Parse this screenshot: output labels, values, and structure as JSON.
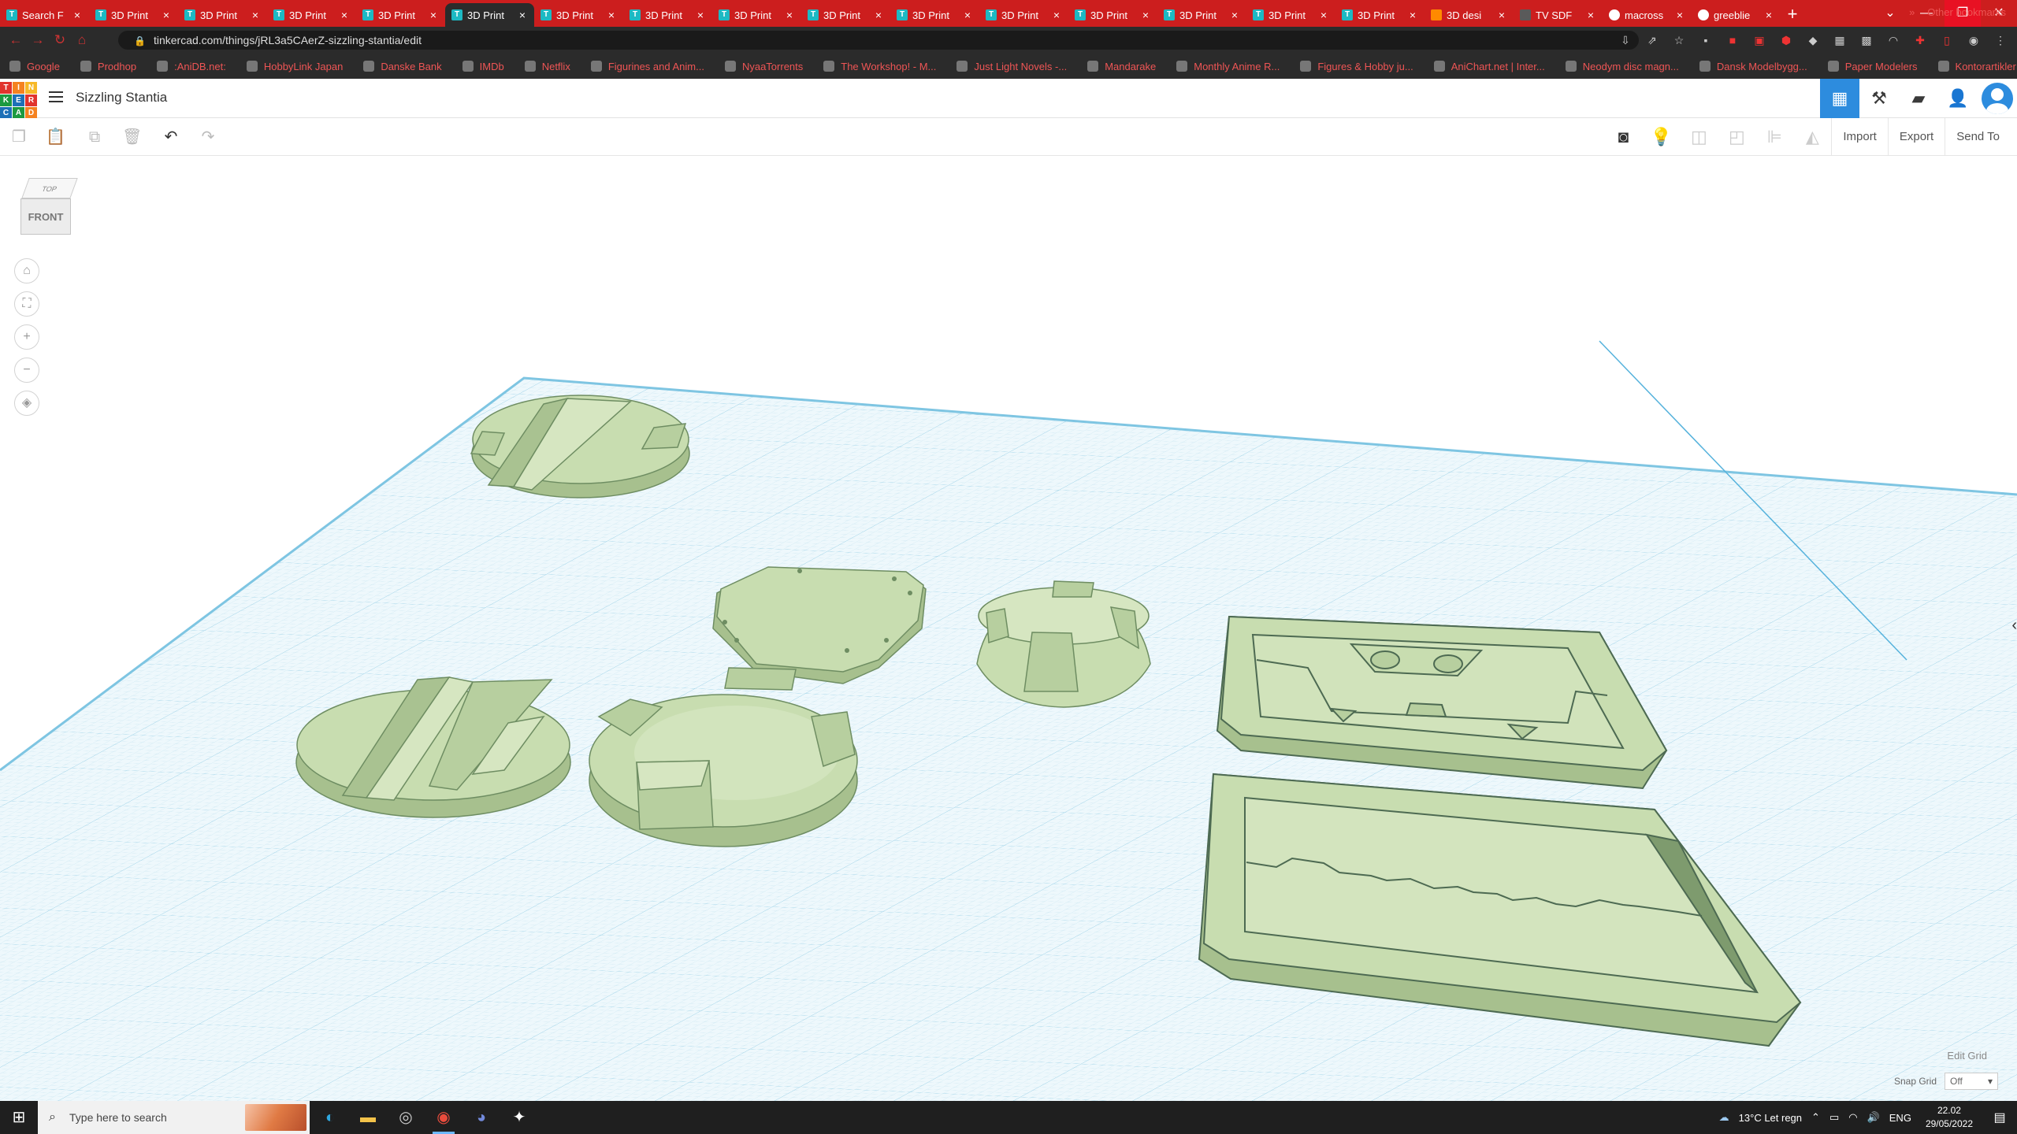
{
  "browser": {
    "tabs": [
      {
        "title": "Search F",
        "icon": "tinkercad"
      },
      {
        "title": "3D Print",
        "icon": "tinkercad"
      },
      {
        "title": "3D Print",
        "icon": "tinkercad"
      },
      {
        "title": "3D Print",
        "icon": "tinkercad"
      },
      {
        "title": "3D Print",
        "icon": "tinkercad"
      },
      {
        "title": "3D Print",
        "icon": "tinkercad",
        "active": true
      },
      {
        "title": "3D Print",
        "icon": "tinkercad"
      },
      {
        "title": "3D Print",
        "icon": "tinkercad"
      },
      {
        "title": "3D Print",
        "icon": "tinkercad"
      },
      {
        "title": "3D Print",
        "icon": "tinkercad"
      },
      {
        "title": "3D Print",
        "icon": "tinkercad"
      },
      {
        "title": "3D Print",
        "icon": "tinkercad"
      },
      {
        "title": "3D Print",
        "icon": "tinkercad"
      },
      {
        "title": "3D Print",
        "icon": "tinkercad"
      },
      {
        "title": "3D Print",
        "icon": "tinkercad"
      },
      {
        "title": "3D Print",
        "icon": "tinkercad"
      },
      {
        "title": "3D desi",
        "icon": "sheet"
      },
      {
        "title": "TV SDF",
        "icon": "tv"
      },
      {
        "title": "macross",
        "icon": "google"
      },
      {
        "title": "greeblie",
        "icon": "google"
      }
    ],
    "new_tab": "+",
    "url": "tinkercad.com/things/jRL3a5CAerZ-sizzling-stantia/edit",
    "bookmarks": [
      "Google",
      "Prodhop",
      ":AniDB.net:",
      "HobbyLink Japan",
      "Danske Bank",
      "IMDb",
      "Netflix",
      "Figurines and Anim...",
      "NyaaTorrents",
      "The Workshop! - M...",
      "Just Light Novels -...",
      "Mandarake",
      "Monthly Anime R...",
      "Figures & Hobby ju...",
      "AniChart.net | Inter...",
      "Neodym disc magn...",
      "Dansk Modelbygg...",
      "Paper Modelers",
      "Kontorartikler - Ho..."
    ],
    "bookmarks_overflow": "»",
    "other_bookmarks": "Other bookmarks"
  },
  "app": {
    "logo_letters": [
      "T",
      "I",
      "N",
      "K",
      "E",
      "R",
      "C",
      "A",
      "D"
    ],
    "logo_colors": [
      "#e1332d",
      "#f58220",
      "#f7b928",
      "#1c9a41",
      "#1d70b7",
      "#e1332d",
      "#1d70b7",
      "#1c9a41",
      "#f58220"
    ],
    "project_title": "Sizzling Stantia"
  },
  "toolbar": {
    "import": "Import",
    "export": "Export",
    "send_to": "Send To"
  },
  "viewcube": {
    "top": "TOP",
    "front": "FRONT"
  },
  "workplane": {
    "edit_grid": "Edit Grid",
    "snap_grid_label": "Snap Grid",
    "snap_grid_value": "Off",
    "shape_color": "#c6dcaa",
    "grid_color": "#9fd3e8"
  },
  "taskbar": {
    "search_placeholder": "Type here to search",
    "weather": "13°C  Let regn",
    "lang": "ENG",
    "time": "22.02",
    "date": "29/05/2022"
  }
}
